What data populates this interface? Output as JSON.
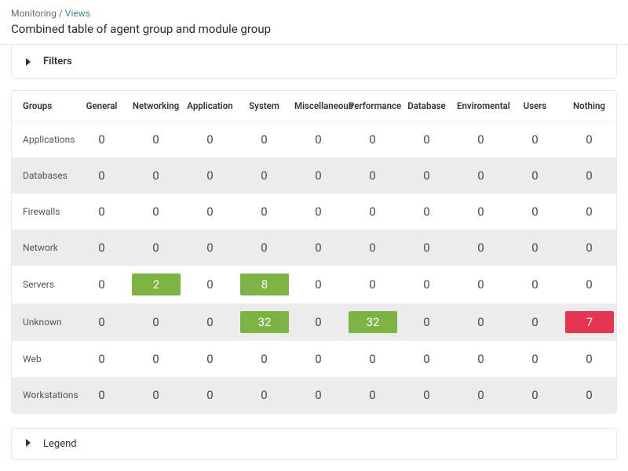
{
  "breadcrumb": {
    "root": "Monitoring",
    "current": "Views"
  },
  "page_title": "Combined table of agent group and module group",
  "filters": {
    "label": "Filters"
  },
  "legend": {
    "label": "Legend"
  },
  "colors": {
    "green": "#7cb342",
    "red": "#e53551"
  },
  "table": {
    "row_header": "Groups",
    "columns": [
      "General",
      "Networking",
      "Application",
      "System",
      "Miscellaneous",
      "Performance",
      "Database",
      "Enviromental",
      "Users",
      "Nothing"
    ],
    "rows": [
      {
        "name": "Applications",
        "cells": [
          {
            "v": 0
          },
          {
            "v": 0
          },
          {
            "v": 0
          },
          {
            "v": 0
          },
          {
            "v": 0
          },
          {
            "v": 0
          },
          {
            "v": 0
          },
          {
            "v": 0
          },
          {
            "v": 0
          },
          {
            "v": 0
          }
        ]
      },
      {
        "name": "Databases",
        "cells": [
          {
            "v": 0
          },
          {
            "v": 0
          },
          {
            "v": 0
          },
          {
            "v": 0
          },
          {
            "v": 0
          },
          {
            "v": 0
          },
          {
            "v": 0
          },
          {
            "v": 0
          },
          {
            "v": 0
          },
          {
            "v": 0
          }
        ]
      },
      {
        "name": "Firewalls",
        "cells": [
          {
            "v": 0
          },
          {
            "v": 0
          },
          {
            "v": 0
          },
          {
            "v": 0
          },
          {
            "v": 0
          },
          {
            "v": 0
          },
          {
            "v": 0
          },
          {
            "v": 0
          },
          {
            "v": 0
          },
          {
            "v": 0
          }
        ]
      },
      {
        "name": "Network",
        "cells": [
          {
            "v": 0
          },
          {
            "v": 0
          },
          {
            "v": 0
          },
          {
            "v": 0
          },
          {
            "v": 0
          },
          {
            "v": 0
          },
          {
            "v": 0
          },
          {
            "v": 0
          },
          {
            "v": 0
          },
          {
            "v": 0
          }
        ]
      },
      {
        "name": "Servers",
        "cells": [
          {
            "v": 0
          },
          {
            "v": 2,
            "c": "green"
          },
          {
            "v": 0
          },
          {
            "v": 8,
            "c": "green"
          },
          {
            "v": 0
          },
          {
            "v": 0
          },
          {
            "v": 0
          },
          {
            "v": 0
          },
          {
            "v": 0
          },
          {
            "v": 0
          }
        ]
      },
      {
        "name": "Unknown",
        "cells": [
          {
            "v": 0
          },
          {
            "v": 0
          },
          {
            "v": 0
          },
          {
            "v": 32,
            "c": "green"
          },
          {
            "v": 0
          },
          {
            "v": 32,
            "c": "green"
          },
          {
            "v": 0
          },
          {
            "v": 0
          },
          {
            "v": 0
          },
          {
            "v": 7,
            "c": "red"
          }
        ]
      },
      {
        "name": "Web",
        "cells": [
          {
            "v": 0
          },
          {
            "v": 0
          },
          {
            "v": 0
          },
          {
            "v": 0
          },
          {
            "v": 0
          },
          {
            "v": 0
          },
          {
            "v": 0
          },
          {
            "v": 0
          },
          {
            "v": 0
          },
          {
            "v": 0
          }
        ]
      },
      {
        "name": "Workstations",
        "cells": [
          {
            "v": 0
          },
          {
            "v": 0
          },
          {
            "v": 0
          },
          {
            "v": 0
          },
          {
            "v": 0
          },
          {
            "v": 0
          },
          {
            "v": 0
          },
          {
            "v": 0
          },
          {
            "v": 0
          },
          {
            "v": 0
          }
        ]
      }
    ]
  }
}
